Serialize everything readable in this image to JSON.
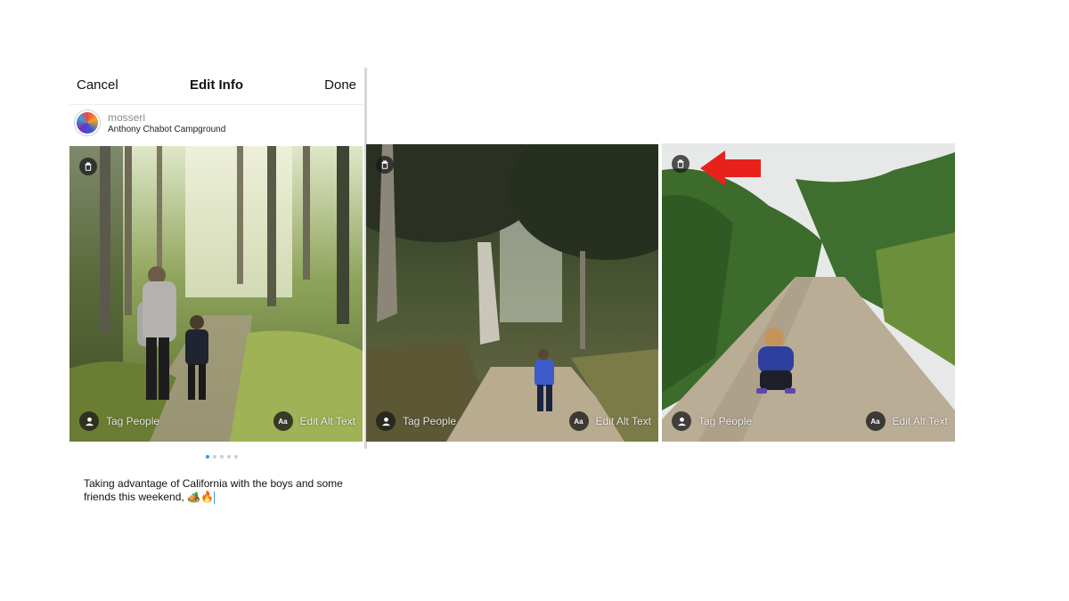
{
  "header": {
    "cancel_label": "Cancel",
    "title": "Edit Info",
    "done_label": "Done"
  },
  "post": {
    "username": "mosseri",
    "location": "Anthony Chabot Campground",
    "caption": "Taking advantage of California with the boys and some friends this weekend, 🏕️🔥"
  },
  "photos": [
    {
      "tag_label": "Tag People",
      "alt_label": "Edit Alt Text",
      "alt_icon": "Aa"
    },
    {
      "tag_label": "Tag People",
      "alt_label": "Edit Alt Text",
      "alt_icon": "Aa"
    },
    {
      "tag_label": "Tag People",
      "alt_label": "Edit Alt Text",
      "alt_icon": "Aa"
    }
  ],
  "carousel": {
    "count": 5,
    "active_index": 0
  },
  "colors": {
    "accent": "#3897f0",
    "annotation_arrow": "#e8211d"
  },
  "icons": [
    "trash-icon",
    "person-icon",
    "alt-text-icon",
    "annotation-arrow-icon"
  ]
}
